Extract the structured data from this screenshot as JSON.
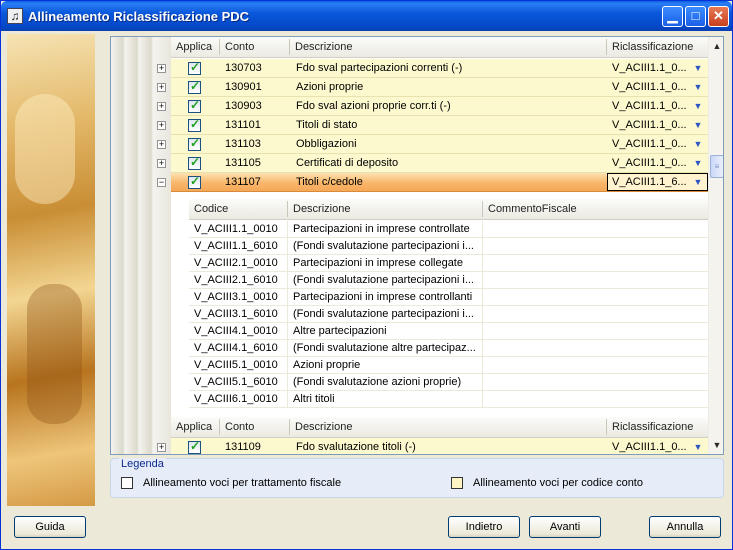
{
  "window": {
    "title": "Allineamento Riclassificazione PDC"
  },
  "grid": {
    "columns": {
      "applica": "Applica",
      "conto": "Conto",
      "descrizione": "Descrizione",
      "riclassificazione": "Riclassificazione"
    },
    "rows": [
      {
        "conto": "130703",
        "descrizione": "Fdo sval partecipazioni correnti (-)",
        "riclassificazione": "V_ACIII1.1_0...",
        "checked": true
      },
      {
        "conto": "130901",
        "descrizione": "Azioni proprie",
        "riclassificazione": "V_ACIII1.1_0...",
        "checked": true
      },
      {
        "conto": "130903",
        "descrizione": "Fdo sval azioni proprie corr.ti (-)",
        "riclassificazione": "V_ACIII1.1_0...",
        "checked": true
      },
      {
        "conto": "131101",
        "descrizione": "Titoli di stato",
        "riclassificazione": "V_ACIII1.1_0...",
        "checked": true
      },
      {
        "conto": "131103",
        "descrizione": "Obbligazioni",
        "riclassificazione": "V_ACIII1.1_0...",
        "checked": true
      },
      {
        "conto": "131105",
        "descrizione": "Certificati di deposito",
        "riclassificazione": "V_ACIII1.1_0...",
        "checked": true
      },
      {
        "conto": "131107",
        "descrizione": "Titoli c/cedole",
        "riclassificazione": "V_ACIII1.1_6...",
        "checked": true,
        "selected": true
      }
    ],
    "after_rows": [
      {
        "conto": "131109",
        "descrizione": "Fdo svalutazione titoli (-)",
        "riclassificazione": "V_ACIII1.1_0...",
        "checked": true
      }
    ]
  },
  "subgrid": {
    "columns": {
      "codice": "Codice",
      "descrizione": "Descrizione",
      "commento": "CommentoFiscale"
    },
    "rows": [
      {
        "codice": "V_ACIII1.1_0010",
        "descrizione": "Partecipazioni in imprese controllate"
      },
      {
        "codice": "V_ACIII1.1_6010",
        "descrizione": "(Fondi svalutazione partecipazioni i..."
      },
      {
        "codice": "V_ACIII2.1_0010",
        "descrizione": "Partecipazioni in imprese collegate"
      },
      {
        "codice": "V_ACIII2.1_6010",
        "descrizione": "(Fondi svalutazione partecipazioni i..."
      },
      {
        "codice": "V_ACIII3.1_0010",
        "descrizione": "Partecipazioni in imprese controllanti"
      },
      {
        "codice": "V_ACIII3.1_6010",
        "descrizione": "(Fondi svalutazione partecipazioni i..."
      },
      {
        "codice": "V_ACIII4.1_0010",
        "descrizione": "Altre partecipazioni"
      },
      {
        "codice": "V_ACIII4.1_6010",
        "descrizione": "(Fondi svalutazione altre partecipaz..."
      },
      {
        "codice": "V_ACIII5.1_0010",
        "descrizione": "Azioni proprie"
      },
      {
        "codice": "V_ACIII5.1_6010",
        "descrizione": "(Fondi svalutazione azioni proprie)"
      },
      {
        "codice": "V_ACIII6.1_0010",
        "descrizione": "Altri titoli"
      }
    ]
  },
  "legend": {
    "title": "Legenda",
    "items": [
      {
        "label": "Allineamento voci per trattamento fiscale",
        "color": "#ffffff"
      },
      {
        "label": "Allineamento voci per codice conto",
        "color": "#fdf5c4"
      }
    ]
  },
  "buttons": {
    "guida": "Guida",
    "indietro": "Indietro",
    "avanti": "Avanti",
    "annulla": "Annulla"
  },
  "colors": {
    "row_bg": "#fdf9cf",
    "selected_row": "#f8b66a",
    "titlebar": "#0a58dc"
  }
}
